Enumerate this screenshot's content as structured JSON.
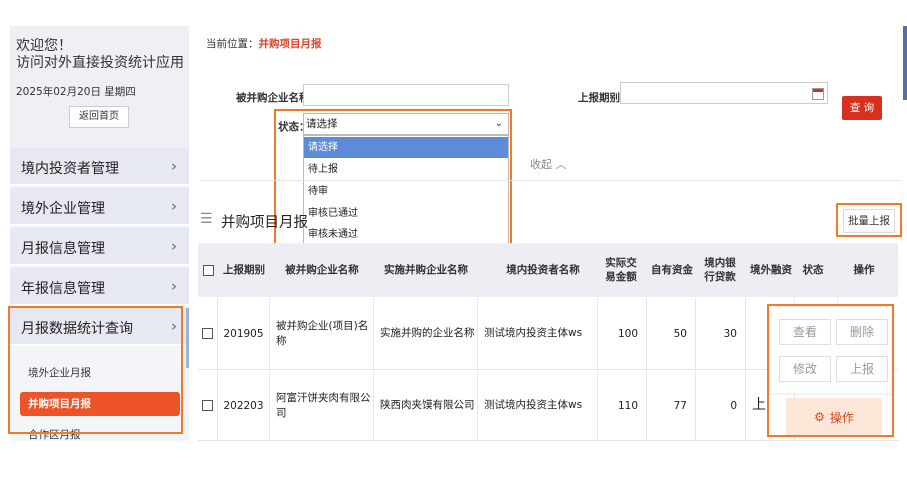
{
  "sidebar": {
    "welcome_line1": "欢迎您！",
    "welcome_line2": "访问对外直接投资统计应用",
    "date": "2025年02月20日 星期四",
    "home_button": "返回首页",
    "menu": [
      {
        "label": "境内投资者管理"
      },
      {
        "label": "境外企业管理"
      },
      {
        "label": "月报信息管理"
      },
      {
        "label": "年报信息管理"
      },
      {
        "label": "月报数据统计查询"
      }
    ],
    "submenu": [
      {
        "label": "境外企业月报"
      },
      {
        "label": "并购项目月报"
      },
      {
        "label": "合作区月报"
      }
    ],
    "chevron": "›"
  },
  "breadcrumb": {
    "prefix": "当前位置：",
    "current": "并购项目月报"
  },
  "filters": {
    "company_label": "被并购企业名称：",
    "period_label": "上报期别：",
    "status_label": "状态：",
    "status_value": "请选择",
    "status_options": [
      "请选择",
      "待上报",
      "待审",
      "审核已通过",
      "审核未通过"
    ],
    "query_button": "查 询",
    "collapse_text": "收起 ︿"
  },
  "list": {
    "title": "并购项目月报",
    "batch_button": "批量上报",
    "columns": [
      "上报期别",
      "被并购企业名称",
      "实施并购企业名称",
      "境内投资者名称",
      "实际交易金额",
      "自有资金",
      "境内银行贷款",
      "境外融资",
      "状态",
      "操作"
    ],
    "rows": [
      {
        "period": "201905",
        "target": "被并购企业(项目)名称",
        "acquirer": "实施并购的企业名称",
        "investor": "测试境内投资主体ws",
        "amount": "100",
        "own": "50",
        "loan": "30",
        "status_frag": ""
      },
      {
        "period": "202203",
        "target": "阿富汗饼夹肉有限公司",
        "acquirer": "陕西肉夹馍有限公司",
        "investor": "测试境内投资主体ws",
        "amount": "110",
        "own": "77",
        "loan": "0",
        "status_frag": "上"
      }
    ]
  },
  "actions": {
    "view": "查看",
    "delete": "删除",
    "edit": "修改",
    "report": "上报",
    "operate": "操作"
  },
  "colors": {
    "accent": "#ec5428",
    "highlight": "#f07a2a",
    "select": "#5d8bd8"
  }
}
